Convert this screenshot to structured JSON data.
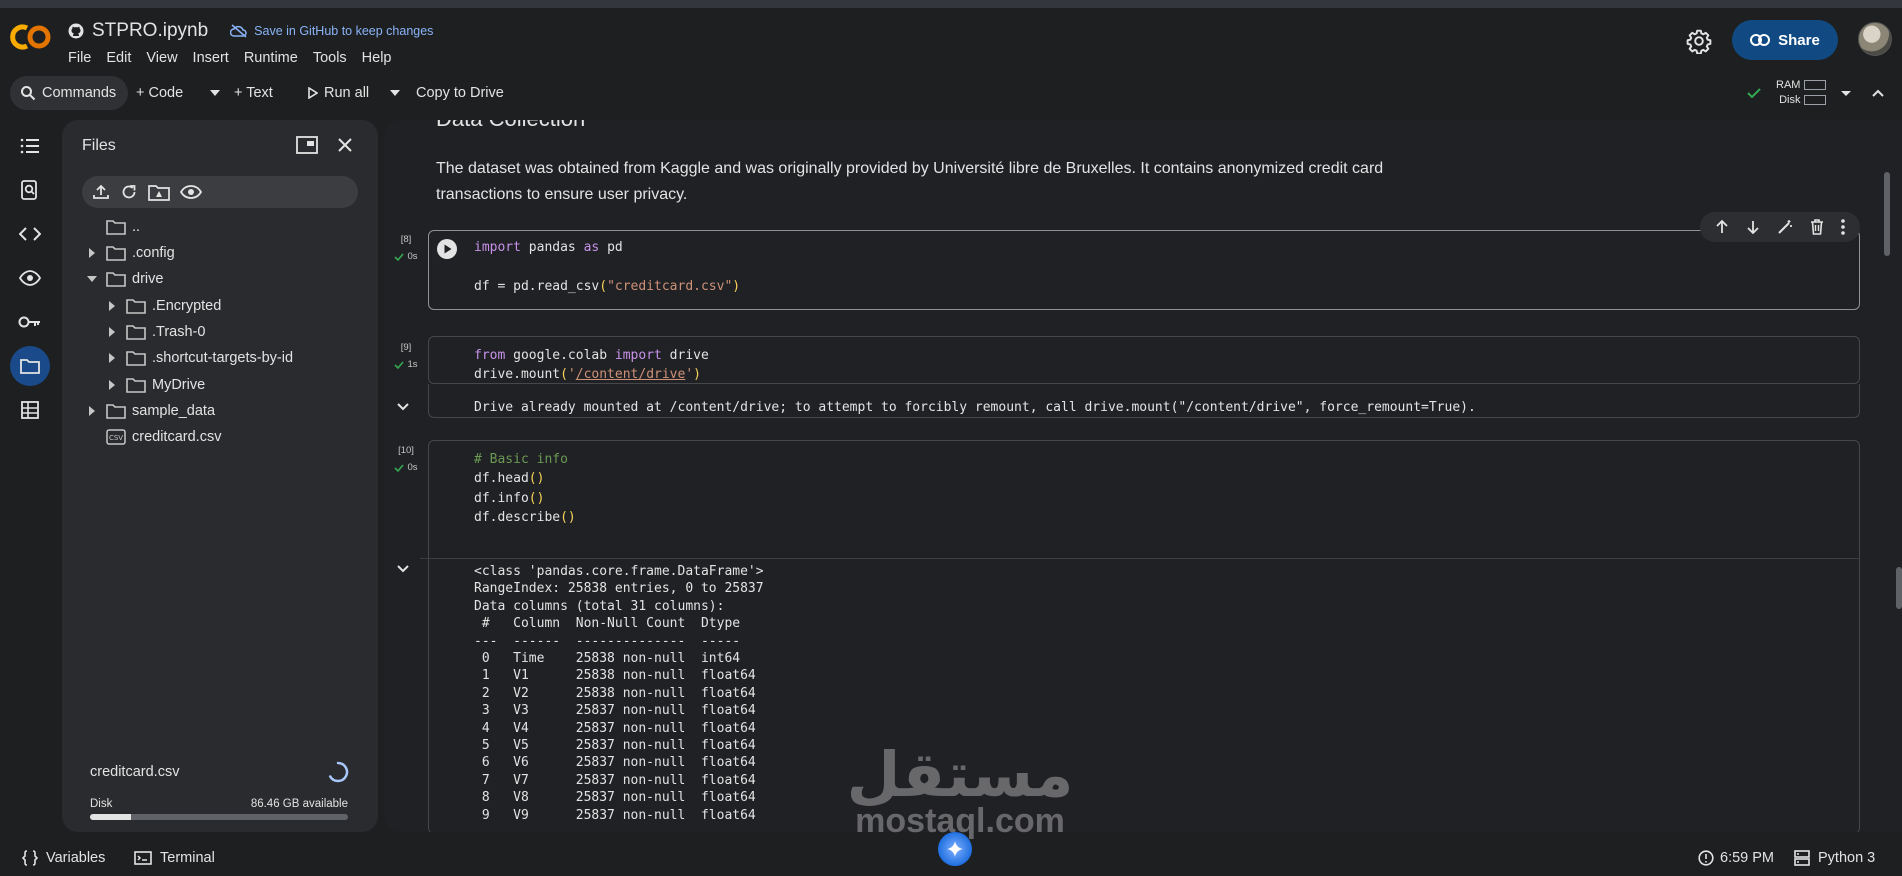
{
  "app": {
    "logo": "CO",
    "title": "STPRO.ipynb",
    "save_note": "Save in GitHub to keep changes",
    "share_label": "Share",
    "brand_color": "#f9ab00"
  },
  "menu": [
    "File",
    "Edit",
    "View",
    "Insert",
    "Runtime",
    "Tools",
    "Help"
  ],
  "toolbar": {
    "commands": "Commands",
    "code": "+ Code",
    "text": "+ Text",
    "run_all": "Run all",
    "copy_to_drive": "Copy to Drive",
    "ram_label": "RAM",
    "disk_label": "Disk"
  },
  "rail": {
    "icons": [
      "table-of-contents-icon",
      "find-icon",
      "code-snippets-icon",
      "variables-inspector-icon",
      "secrets-key-icon",
      "files-icon",
      "data-table-icon"
    ]
  },
  "files": {
    "title": "Files",
    "tree": [
      {
        "label": "..",
        "type": "folder"
      },
      {
        "label": ".config",
        "type": "folder"
      },
      {
        "label": "drive",
        "type": "folder"
      },
      {
        "label": ".Encrypted",
        "type": "folder"
      },
      {
        "label": ".Trash-0",
        "type": "folder"
      },
      {
        "label": ".shortcut-targets-by-id",
        "type": "folder"
      },
      {
        "label": "MyDrive",
        "type": "folder"
      },
      {
        "label": "sample_data",
        "type": "folder"
      },
      {
        "label": "creditcard.csv",
        "type": "csv"
      }
    ],
    "upload_status": "creditcard.csv",
    "disk_label": "Disk",
    "disk_available": "86.46 GB available",
    "disk_used_fraction": 0.16
  },
  "notebook": {
    "md_heading": "Data Collection",
    "md_text": "The dataset was obtained from Kaggle and was originally provided by Université libre de Bruxelles. It contains anonymized credit card transactions to ensure user privacy.",
    "cells": [
      {
        "exec": "[8]",
        "time": "0s",
        "code": [
          "import pandas as pd",
          "",
          "df = pd.read_csv(\"creditcard.csv\")"
        ]
      },
      {
        "exec": "[9]",
        "time": "1s",
        "code": [
          "from google.colab import drive",
          "drive.mount('/content/drive')"
        ],
        "output": "Drive already mounted at /content/drive; to attempt to forcibly remount, call drive.mount(\"/content/drive\", force_remount=True)."
      },
      {
        "exec": "[10]",
        "time": "0s",
        "code": [
          "# Basic info",
          "df.head()",
          "df.info()",
          "df.describe()"
        ],
        "output_lines": [
          "<class 'pandas.core.frame.DataFrame'>",
          "RangeIndex: 25838 entries, 0 to 25837",
          "Data columns (total 31 columns):",
          " #   Column  Non-Null Count  Dtype  ",
          "---  ------  --------------  -----  ",
          " 0   Time    25838 non-null  int64  ",
          " 1   V1      25838 non-null  float64",
          " 2   V2      25838 non-null  float64",
          " 3   V3      25837 non-null  float64",
          " 4   V4      25837 non-null  float64",
          " 5   V5      25837 non-null  float64",
          " 6   V6      25837 non-null  float64",
          " 7   V7      25837 non-null  float64",
          " 8   V8      25837 non-null  float64",
          " 9   V9      25837 non-null  float64"
        ]
      }
    ]
  },
  "watermark": {
    "arabic": "مستقل",
    "latin": "mostaql.com"
  },
  "status": {
    "variables": "Variables",
    "terminal": "Terminal",
    "time": "6:59 PM",
    "runtime": "Python 3"
  }
}
